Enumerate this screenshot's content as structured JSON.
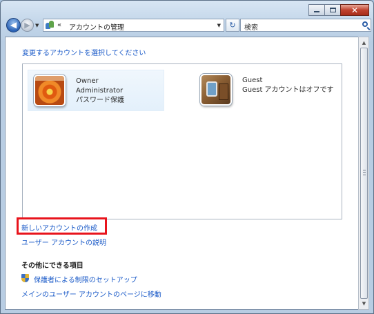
{
  "window": {
    "address_path": "アカウントの管理",
    "address_chevron": "«",
    "search_placeholder": "検索"
  },
  "main": {
    "heading": "変更するアカウントを選択してください",
    "accounts": [
      {
        "name": "Owner",
        "role": "Administrator",
        "status": "パスワード保護",
        "picture": "orange-flower-picture"
      },
      {
        "name": "Guest",
        "status": "Guest アカウントはオフです",
        "picture": "guest-briefcase-picture"
      }
    ],
    "links": {
      "create_account": "新しいアカウントの作成",
      "explain_accounts": "ユーザー アカウントの説明"
    },
    "other": {
      "heading": "その他にできる項目",
      "parental_controls": "保護者による制限のセットアップ",
      "main_page": "メインのユーザー アカウントのページに移動"
    }
  },
  "colors": {
    "link": "#1a5ac8",
    "highlight": "#e8141c",
    "close": "#c0432f"
  }
}
